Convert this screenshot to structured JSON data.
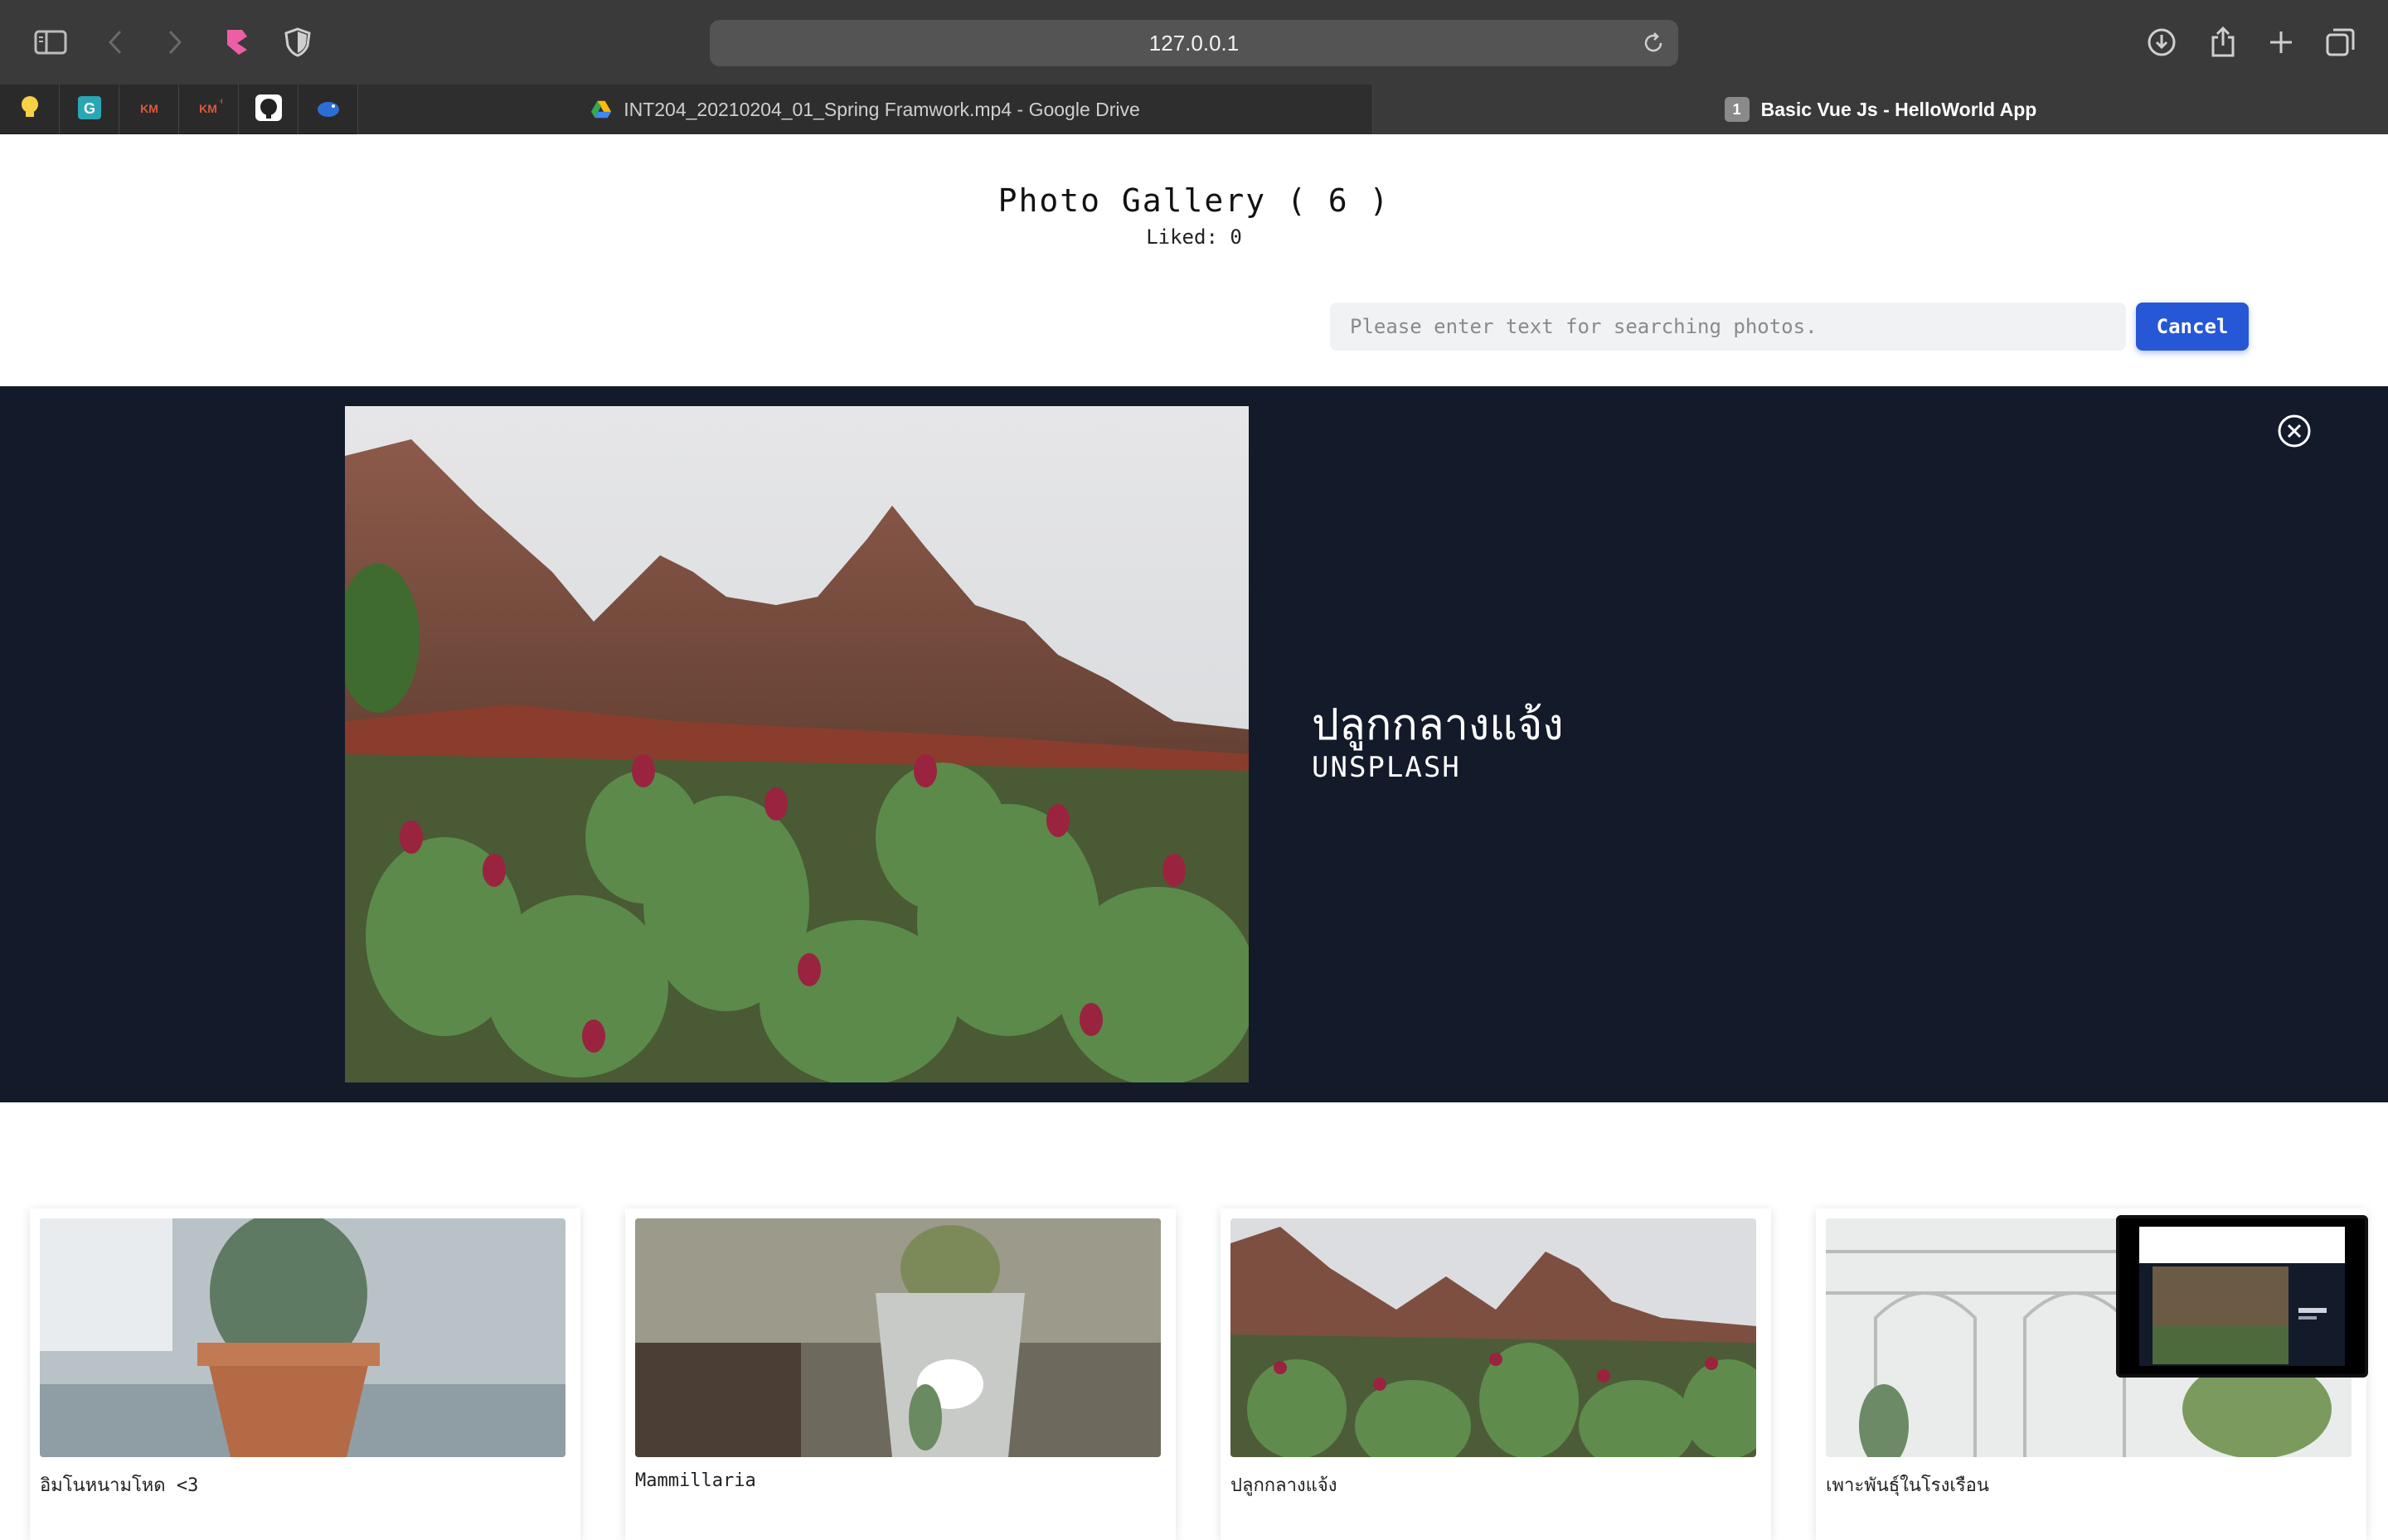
{
  "browser": {
    "url": "127.0.0.1",
    "tabs": [
      {
        "label": "INT204_20210204_01_Spring Framwork.mp4 - Google Drive",
        "active": false
      },
      {
        "label": "Basic Vue Js - HelloWorld App",
        "active": true,
        "badge": "1"
      }
    ],
    "favorites": [
      "lightbulb-icon",
      "grammarly-icon",
      "kmutt-icon",
      "kmutt-plus-icon",
      "github-icon",
      "bird-icon"
    ],
    "colors": {
      "toolbar": "#3a3a3a",
      "tabbar": "#2a2a2a",
      "url_bar": "#545454"
    }
  },
  "gallery": {
    "title": "Photo Gallery ( 6 )",
    "liked": "Liked: 0",
    "search_placeholder": "Please enter text for searching photos.",
    "cancel_label": "Cancel",
    "accent": "#2557d6"
  },
  "modal": {
    "title": "ปลูกกลางแจ้ง",
    "subtitle": "UNSPLASH",
    "background": "#131a2a"
  },
  "cards": [
    {
      "caption": "อิมโนหนามโหด <3"
    },
    {
      "caption": "Mammillaria"
    },
    {
      "caption": "ปลูกกลางแจ้ง"
    },
    {
      "caption": "เพาะพันธุ์ในโรงเรือน"
    }
  ]
}
